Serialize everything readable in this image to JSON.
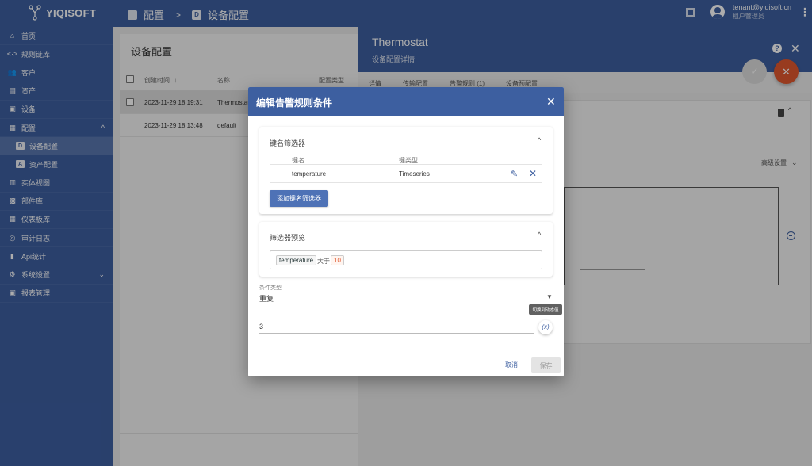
{
  "app": {
    "logo_text": "YIQISOFT"
  },
  "header": {
    "crumb_1": "配置",
    "crumb_sep": ">",
    "crumb_2_icon": "D",
    "crumb_2": "设备配置",
    "user_email": "tenant@yiqisoft.cn",
    "user_role": "租户管理员"
  },
  "sidebar": {
    "items": [
      {
        "label": "首页",
        "icon": "home-icon",
        "glyph": "⌂"
      },
      {
        "label": "规则链库",
        "icon": "rule-chain-icon",
        "glyph": "<·>"
      },
      {
        "label": "客户",
        "icon": "customers-icon",
        "glyph": "👥"
      },
      {
        "label": "资产",
        "icon": "assets-icon",
        "glyph": "▤"
      },
      {
        "label": "设备",
        "icon": "devices-icon",
        "glyph": "▣"
      },
      {
        "label": "配置",
        "icon": "profiles-icon",
        "glyph": "▦"
      },
      {
        "label": "设备配置",
        "icon": "D",
        "sub": true
      },
      {
        "label": "资产配置",
        "icon": "A",
        "sub": true
      },
      {
        "label": "实体视图",
        "icon": "entity-view-icon",
        "glyph": "▥"
      },
      {
        "label": "部件库",
        "icon": "widgets-icon",
        "glyph": "▩"
      },
      {
        "label": "仪表板库",
        "icon": "dashboards-icon",
        "glyph": "▦"
      },
      {
        "label": "审计日志",
        "icon": "audit-log-icon",
        "glyph": "◎"
      },
      {
        "label": "Api统计",
        "icon": "api-stats-icon",
        "glyph": "▮"
      },
      {
        "label": "系统设置",
        "icon": "settings-icon",
        "glyph": "⚙"
      },
      {
        "label": "报表管理",
        "icon": "reports-icon",
        "glyph": "▣"
      }
    ]
  },
  "list": {
    "title": "设备配置",
    "columns": [
      "创建时间",
      "名称",
      "配置类型"
    ],
    "sort_arrow": "↓",
    "rows": [
      {
        "created": "2023-11-29 18:19:31",
        "name": "Thermostat"
      },
      {
        "created": "2023-11-29 18:13:48",
        "name": "default"
      }
    ]
  },
  "detail": {
    "title": "Thermostat",
    "subtitle": "设备配置详情",
    "tabs": [
      "详情",
      "传输配置",
      "告警规则 (1)",
      "设备预配置"
    ],
    "advanced": "高级设置"
  },
  "dialog": {
    "title": "编辑告警规则条件",
    "key_filters": {
      "title": "键名筛选器",
      "col_key": "键名",
      "col_type": "键类型",
      "rows": [
        {
          "key": "temperature",
          "type": "Timeseries"
        }
      ],
      "add_label": "添加键名筛选器"
    },
    "preview": {
      "title": "筛选器预览",
      "key": "temperature",
      "op": "大于",
      "value": "10"
    },
    "condition_type_label": "条件类型",
    "condition_type": "重复",
    "tooltip": "切换到动态值",
    "count_value": "3",
    "dynamic_btn": "(x)",
    "cancel": "取消",
    "save": "保存"
  }
}
